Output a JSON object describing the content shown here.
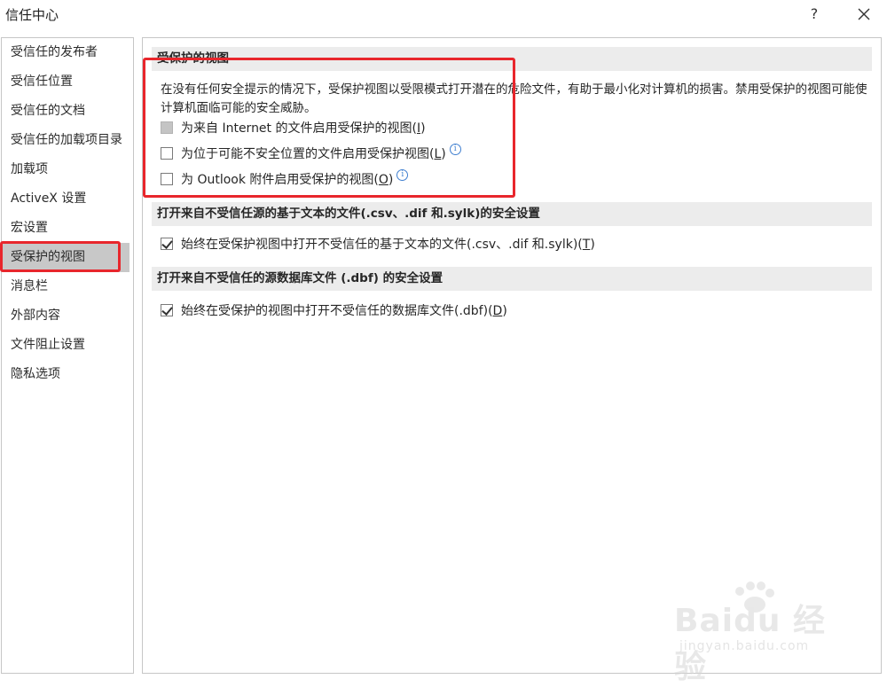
{
  "window": {
    "title": "信任中心",
    "help_label": "?",
    "close_icon": "close-icon"
  },
  "sidebar": {
    "items": [
      {
        "label": "受信任的发布者"
      },
      {
        "label": "受信任位置"
      },
      {
        "label": "受信任的文档"
      },
      {
        "label": "受信任的加载项目录"
      },
      {
        "label": "加载项"
      },
      {
        "label": "ActiveX 设置"
      },
      {
        "label": "宏设置"
      },
      {
        "label": "受保护的视图"
      },
      {
        "label": "消息栏"
      },
      {
        "label": "外部内容"
      },
      {
        "label": "文件阻止设置"
      },
      {
        "label": "隐私选项"
      }
    ],
    "active_index": 7
  },
  "main": {
    "protected_view": {
      "header": "受保护的视图",
      "description": "在没有任何安全提示的情况下，受保护视图以受限模式打开潜在的危险文件，有助于最小化对计算机的损害。禁用受保护的视图可能使计算机面临可能的安全威胁。",
      "options": [
        {
          "label_pre": "为来自 Internet 的文件启用受保护的视图(",
          "key": "I",
          "label_post": ")",
          "checked": false,
          "disabled": true,
          "info": false
        },
        {
          "label_pre": "为位于可能不安全位置的文件启用受保护视图(",
          "key": "L",
          "label_post": ")",
          "checked": false,
          "disabled": false,
          "info": true
        },
        {
          "label_pre": "为 Outlook 附件启用受保护的视图(",
          "key": "O",
          "label_post": ")",
          "checked": false,
          "disabled": false,
          "info": true
        }
      ]
    },
    "text_files": {
      "header": "打开来自不受信任源的基于文本的文件(.csv、.dif 和.sylk)的安全设置",
      "option": {
        "label_pre": "始终在受保护视图中打开不受信任的基于文本的文件(.csv、.dif 和.sylk)(",
        "key": "T",
        "label_post": ")",
        "checked": true
      }
    },
    "dbf_files": {
      "header": "打开来自不受信任的源数据库文件 (.dbf) 的安全设置",
      "option": {
        "label_pre": "始终在受保护的视图中打开不受信任的数据库文件(.dbf)(",
        "key": "D",
        "label_post": ")",
        "checked": true
      }
    }
  },
  "watermark": {
    "brand": "Baidu 经验",
    "url": "jingyan.baidu.com"
  },
  "colors": {
    "highlight_red": "#e8262c",
    "active_item_bg": "#c8c8c8",
    "section_header_bg": "#ececec",
    "info_blue": "#3f7fd0"
  }
}
